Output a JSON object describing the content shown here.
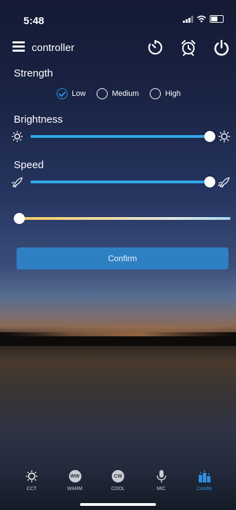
{
  "status": {
    "time": "5:48"
  },
  "app": {
    "title": "controller"
  },
  "strength": {
    "label": "Strength",
    "options": [
      "Low",
      "Medium",
      "High"
    ],
    "selected": "Low"
  },
  "brightness": {
    "label": "Brightness",
    "value_fraction": 1.0
  },
  "speed": {
    "label": "Speed",
    "value_fraction": 1.0
  },
  "temperature": {
    "value_fraction": 0.0
  },
  "confirm": {
    "label": "Confirm"
  },
  "nav": {
    "items": [
      {
        "label": "CCT",
        "icon": "sun-icon"
      },
      {
        "label": "WARM",
        "icon": "ww-icon",
        "glyph": "WW"
      },
      {
        "label": "COOL",
        "icon": "cw-icon",
        "glyph": "CW"
      },
      {
        "label": "MIC",
        "icon": "mic-icon"
      },
      {
        "label": "Candle",
        "icon": "candle-icon"
      }
    ],
    "active": "Candle"
  },
  "colors": {
    "accent": "#2f8fe0",
    "slider": "#2fa8e6",
    "confirm_bg": "#2f7fc3"
  }
}
